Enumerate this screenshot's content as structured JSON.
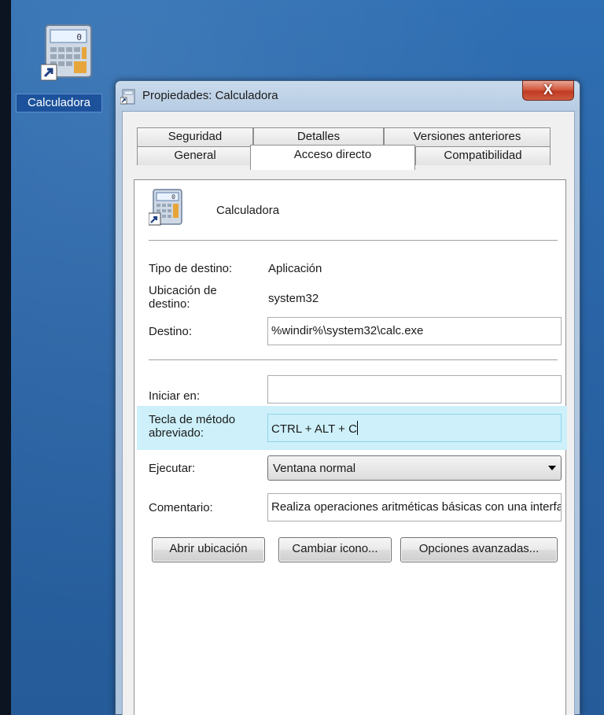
{
  "desktop": {
    "icon_label": "Calculadora",
    "icon_name": "calculator-shortcut-icon"
  },
  "window": {
    "title": "Propiedades: Calculadora",
    "close_label": "X"
  },
  "tabs": {
    "row_back": [
      "Seguridad",
      "Detalles",
      "Versiones anteriores"
    ],
    "row_front": [
      "General",
      "Acceso directo",
      "Compatibilidad"
    ],
    "active": "Acceso directo"
  },
  "shortcut": {
    "name": "Calculadora",
    "target_type_label": "Tipo de destino:",
    "target_type_value": "Aplicación",
    "target_location_label": "Ubicación de destino:",
    "target_location_value": "system32",
    "target_label": "Destino:",
    "target_value": "%windir%\\system32\\calc.exe",
    "start_in_label": "Iniciar en:",
    "start_in_value": "",
    "hotkey_label": "Tecla de método abreviado:",
    "hotkey_value": "CTRL + ALT + C",
    "run_label": "Ejecutar:",
    "run_value": "Ventana normal",
    "comment_label": "Comentario:",
    "comment_value": "Realiza operaciones aritméticas básicas con una interfaz de usuario sencilla."
  },
  "buttons": {
    "open_location": "Abrir ubicación",
    "change_icon": "Cambiar icono...",
    "advanced": "Opciones avanzadas..."
  },
  "colors": {
    "desktop": "#2a64a6",
    "hotkey_highlight": "#cdf0fa",
    "close_button": "#c03a22"
  }
}
